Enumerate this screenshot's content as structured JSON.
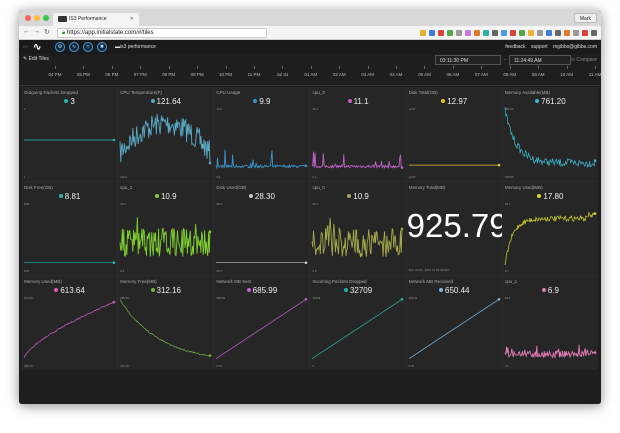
{
  "browser": {
    "tab_title": "IS3 Performance",
    "url": "https://app.initialstate.com/#/tiles",
    "profile_name": "Mark",
    "extension_colors": [
      "#e9b12f",
      "#3b7dd8",
      "#d9443a",
      "#58a84a",
      "#999",
      "#c47ad6",
      "#e07b2a",
      "#2ab3a6",
      "#666",
      "#4a9be0",
      "#d9443a",
      "#58a84a",
      "#e9b12f",
      "#999",
      "#3b7dd8",
      "#666",
      "#e07b2a",
      "#999",
      "#d9443a",
      "#666"
    ]
  },
  "app": {
    "header_label": "IS+",
    "logo_text": "∿",
    "app_buttons": [
      "settings-icon",
      "activity-icon",
      "chart-icon",
      "delete-icon"
    ],
    "app_button_glyphs": [
      "⚙",
      "∿",
      "≈",
      "✖"
    ],
    "bucket_name": "is3 performance",
    "links": {
      "feedback": "feedback",
      "support": "support",
      "account": "mgibbs@gibbs.com"
    },
    "edit_tiles": "Edit Tiles",
    "time_start": "03:11:30 PM",
    "time_end": "11:24:49 AM",
    "time_sep": "-",
    "compare": "Compare"
  },
  "timeline": {
    "ticks": [
      "04 PM",
      "05 PM",
      "06 PM",
      "07 PM",
      "08 PM",
      "09 PM",
      "10 PM",
      "11 PM",
      "Jul 31",
      "01 AM",
      "02 AM",
      "03 AM",
      "04 AM",
      "05 AM",
      "06 AM",
      "07 AM",
      "08 AM",
      "09 AM",
      "10 AM",
      "11 AM"
    ]
  },
  "tiles": [
    {
      "title": "Outgoing Packets Dropped",
      "value": "3",
      "color": "#27b5b0",
      "kind": "flat",
      "level": 0.5,
      "ax_top": "2",
      "ax_bottom": "1"
    },
    {
      "title": "CPU Temperature(F)",
      "value": "121.64",
      "color": "#5aa9c4",
      "kind": "noisy_u",
      "ax_top": "",
      "ax_bottom": "110.0"
    },
    {
      "title": "CPU Usage",
      "value": "9.9",
      "color": "#3a93c9",
      "kind": "spike_low",
      "ax_top": "42.8",
      "ax_bottom": "0.3"
    },
    {
      "title": "cpu_3",
      "value": "11.1",
      "color": "#c060c8",
      "kind": "spike_low",
      "ax_top": "56.3",
      "ax_bottom": "0.1"
    },
    {
      "title": "Disk Total(GB)",
      "value": "12.97",
      "color": "#e0c42a",
      "kind": "flat",
      "level": 0.12,
      "ax_top": "12.97",
      "ax_bottom": "12.97"
    },
    {
      "title": "Memory Available(MB)",
      "value": "761.20",
      "color": "#3ab8cf",
      "kind": "decay",
      "ax_top": "951.93",
      "ax_bottom": "748.69"
    },
    {
      "title": "Disk Free(GB)",
      "value": "8.81",
      "color": "#27b5b0",
      "kind": "flat",
      "level": 0.08,
      "ax_top": "8.82",
      "ax_bottom": "8.81"
    },
    {
      "title": "cpu_2",
      "value": "10.9",
      "color": "#7fd12f",
      "kind": "noisy_mid",
      "ax_top": "43.0",
      "ax_bottom": "0.3"
    },
    {
      "title": "Disk Used(GB)",
      "value": "28.30",
      "color": "#c8c8c8",
      "kind": "flat",
      "level": 0.08,
      "ax_top": "28.3",
      "ax_bottom": "28.3"
    },
    {
      "title": "cpu_0",
      "value": "10.9",
      "color": "#a6a84a",
      "kind": "noisy_mid",
      "ax_top": "60.3",
      "ax_bottom": "0.8"
    },
    {
      "title": "Memory Total(MB)",
      "value": "925.79",
      "color": "#ffffff",
      "kind": "big",
      "stamp": "Sun Jul 31, 2016 11:24:49 AM"
    },
    {
      "title": "Memory Used(MB)",
      "value": "17.80",
      "color": "#d6d62a",
      "kind": "rise",
      "ax_top": "18.1",
      "ax_bottom": "4.7"
    },
    {
      "title": "Memory Used(MB)",
      "value": "613.64",
      "color": "#d65ac8",
      "kind": "log_rise",
      "ax_top": "613.64",
      "ax_bottom": "238.79"
    },
    {
      "title": "Memory Free(MB)",
      "value": "312.16",
      "color": "#7ab040",
      "kind": "log_fall",
      "ax_top": "485.60",
      "ax_bottom": "312.16"
    },
    {
      "title": "Network MB Sent",
      "value": "685.99",
      "color": "#c85ad6",
      "kind": "linear",
      "ax_top": "685.99",
      "ax_bottom": "0.03"
    },
    {
      "title": "Incoming Packets Dropped",
      "value": "32709",
      "color": "#2ab3a0",
      "kind": "linear",
      "ax_top": "32709",
      "ax_bottom": "0"
    },
    {
      "title": "Network MB Received",
      "value": "650.44",
      "color": "#7ab8e8",
      "kind": "linear",
      "ax_top": "650.44",
      "ax_bottom": "0.03"
    },
    {
      "title": "cpu_1",
      "value": "6.9",
      "color": "#e07ab6",
      "kind": "noisy_low",
      "ax_top": "51.3",
      "ax_bottom": "0.1"
    }
  ]
}
